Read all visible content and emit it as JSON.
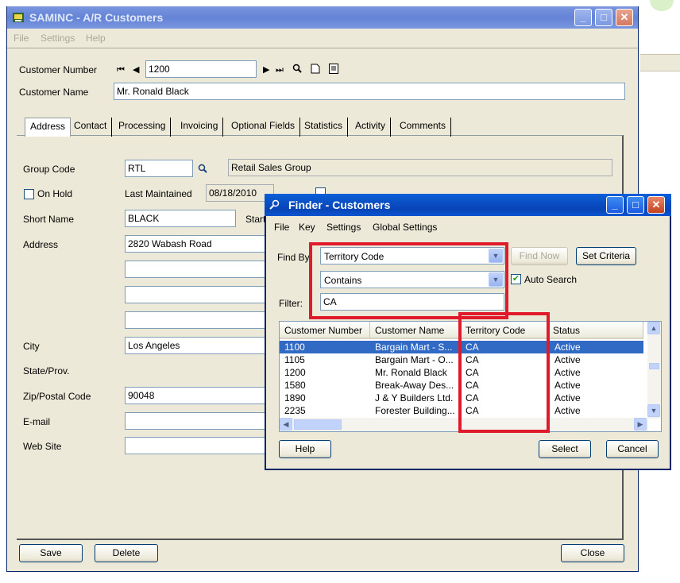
{
  "main": {
    "title": "SAMINC - A/R Customers",
    "menu": [
      "File",
      "Settings",
      "Help"
    ],
    "customer_number_label": "Customer Number",
    "customer_number": "1200",
    "customer_name_label": "Customer Name",
    "customer_name": "Mr. Ronald Black",
    "tabs": [
      "Address",
      "Contact",
      "Processing",
      "Invoicing",
      "Optional Fields",
      "Statistics",
      "Activity",
      "Comments"
    ],
    "group_code_label": "Group Code",
    "group_code": "RTL",
    "group_desc": "Retail Sales Group",
    "on_hold_label": "On Hold",
    "last_maintained_label": "Last Maintained",
    "last_maintained": "08/18/2010",
    "short_name_label": "Short Name",
    "short_name": "BLACK",
    "start_label": "Start",
    "address_label": "Address",
    "address1": "2820 Wabash Road",
    "city_label": "City",
    "city": "Los Angeles",
    "state_label": "State/Prov.",
    "zip_label": "Zip/Postal Code",
    "zip": "90048",
    "email_label": "E-mail",
    "website_label": "Web Site",
    "save_label": "Save",
    "delete_label": "Delete",
    "close_label": "Close"
  },
  "finder": {
    "title": "Finder - Customers",
    "menu": [
      "File",
      "Key",
      "Settings",
      "Global Settings"
    ],
    "find_by_label": "Find By",
    "find_by": "Territory Code",
    "operator": "Contains",
    "filter_label": "Filter:",
    "filter": "CA",
    "find_now_label": "Find Now",
    "set_criteria_label": "Set Criteria",
    "auto_search_label": "Auto Search",
    "columns": [
      "Customer Number",
      "Customer Name",
      "Territory Code",
      "Status"
    ],
    "rows": [
      {
        "number": "1100",
        "name": "Bargain Mart - S...",
        "territory": "CA",
        "status": "Active"
      },
      {
        "number": "1105",
        "name": "Bargain Mart - O...",
        "territory": "CA",
        "status": "Active"
      },
      {
        "number": "1200",
        "name": "Mr. Ronald Black",
        "territory": "CA",
        "status": "Active"
      },
      {
        "number": "1580",
        "name": "Break-Away Des...",
        "territory": "CA",
        "status": "Active"
      },
      {
        "number": "1890",
        "name": "J & Y Builders Ltd.",
        "territory": "CA",
        "status": "Active"
      },
      {
        "number": "2235",
        "name": "Forester Building...",
        "territory": "CA",
        "status": "Active"
      }
    ],
    "help_label": "Help",
    "select_label": "Select",
    "cancel_label": "Cancel"
  },
  "colors": {
    "highlight": "#e0192b",
    "selection": "#316ac5",
    "titlebar": "#0a4fc4"
  }
}
